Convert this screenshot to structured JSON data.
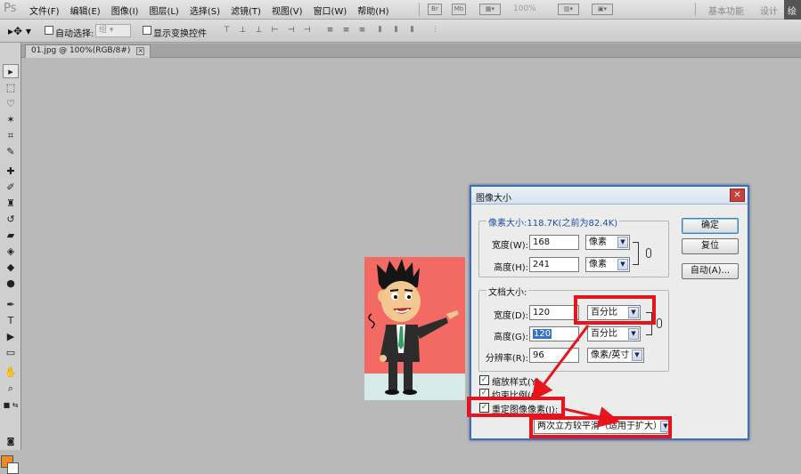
{
  "app": {
    "logo": "Ps"
  },
  "menu": [
    "文件(F)",
    "编辑(E)",
    "图像(I)",
    "图层(L)",
    "选择(S)",
    "滤镜(T)",
    "视图(V)",
    "窗口(W)",
    "帮助(H)"
  ],
  "menubar": {
    "zoom": "100%",
    "workspaces": [
      "基本功能",
      "设计"
    ],
    "active_workspace": "绘"
  },
  "options": {
    "auto_select_label": "自动选择:",
    "auto_select_value": "组",
    "show_transform_label": "显示变换控件"
  },
  "document": {
    "tab_title": "01.jpg @ 100%(RGB/8#)",
    "close_glyph": "×"
  },
  "colors": {
    "accent": "#3874c6",
    "annotation": "#e8141b",
    "foreground": "#f08a1e",
    "image_bg": "#f26a63"
  },
  "dialog": {
    "title": "图像大小",
    "close_glyph": "✕",
    "pixel_dimensions": {
      "legend": "像素大小:118.7K(之前为82.4K)",
      "width_label": "宽度(W):",
      "width_value": "168",
      "width_unit": "像素",
      "height_label": "高度(H):",
      "height_value": "241",
      "height_unit": "像素"
    },
    "document_size": {
      "legend": "文档大小:",
      "width_label": "宽度(D):",
      "width_value": "120",
      "width_unit": "百分比",
      "height_label": "高度(G):",
      "height_value": "120",
      "height_unit": "百分比",
      "resolution_label": "分辨率(R):",
      "resolution_value": "96",
      "resolution_unit": "像素/英寸"
    },
    "checkboxes": {
      "scale_styles": "缩放样式(Y)",
      "constrain": "约束比例(C",
      "resample": "重定图像像素(I):"
    },
    "resample_method": "两次立方较平滑（适用于扩大）",
    "buttons": {
      "ok": "确定",
      "reset": "复位",
      "auto": "自动(A)..."
    }
  }
}
